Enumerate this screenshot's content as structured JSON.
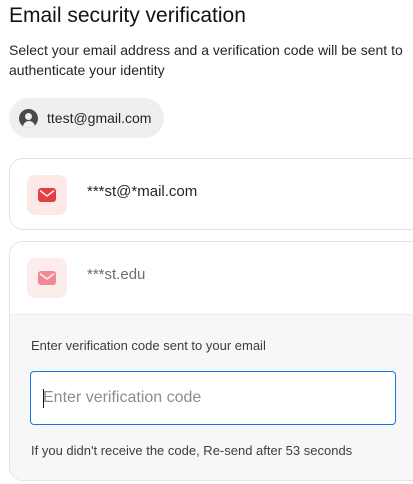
{
  "page": {
    "title": "Email security verification",
    "subtitle": "Select your email address and a verification code will be sent to authenticate your identity"
  },
  "account": {
    "icon": "account-circle-icon",
    "email": "ttest@gmail.com"
  },
  "options": [
    {
      "icon": "mail-icon",
      "masked_email": "***st@*mail.com",
      "accent": "#e53d47"
    },
    {
      "icon": "mail-icon",
      "masked_email": "***st.edu",
      "accent": "#f08a90"
    }
  ],
  "verification": {
    "label": "Enter verification code sent to your email",
    "input_value": "",
    "input_placeholder": "Enter verification code",
    "resend_note": "If you didn't receive the code, Re-send after 53 seconds",
    "focus_color": "#1a73e8"
  }
}
